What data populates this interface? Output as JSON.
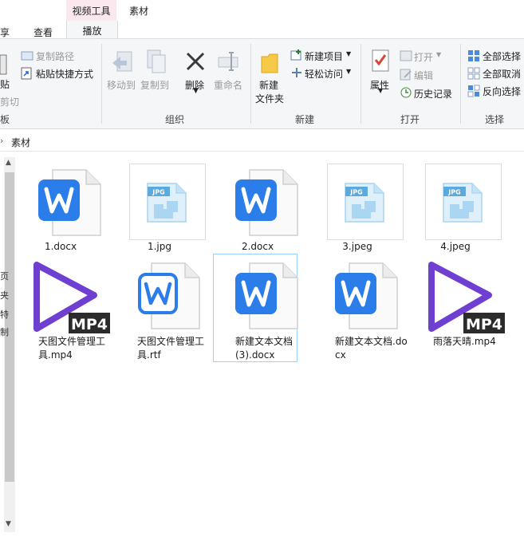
{
  "tabs": {
    "contextual_group": "视频工具",
    "share": "享",
    "view": "查看",
    "play": "播放",
    "folder_title": "素材"
  },
  "ribbon": {
    "clipboard": {
      "paste_fragment": "贴",
      "copy_path": "复制路径",
      "paste_shortcut": "粘贴快捷方式",
      "cut_fragment": "剪切",
      "label": "板"
    },
    "organize": {
      "move_to": "移动到",
      "copy_to": "复制到",
      "delete": "删除",
      "rename": "重命名",
      "label": "组织"
    },
    "new": {
      "new_folder_line1": "新建",
      "new_folder_line2": "文件夹",
      "new_item": "新建项目",
      "easy_access": "轻松访问",
      "label": "新建"
    },
    "open": {
      "properties": "属性",
      "open": "打开",
      "edit": "编辑",
      "history": "历史记录",
      "label": "打开"
    },
    "select": {
      "select_all": "全部选择",
      "select_none": "全部取消",
      "invert": "反向选择",
      "label": "选择"
    }
  },
  "address": {
    "path": "素材"
  },
  "nav_fragments": [
    "页",
    "夹",
    "特",
    "制"
  ],
  "files": [
    {
      "name": "1.docx",
      "type": "word-doc",
      "selected": false
    },
    {
      "name": "1.jpg",
      "type": "jpg",
      "selected": false
    },
    {
      "name": "2.docx",
      "type": "word-doc",
      "selected": false
    },
    {
      "name": "3.jpeg",
      "type": "jpg",
      "selected": false
    },
    {
      "name": "4.jpeg",
      "type": "jpg",
      "selected": false
    },
    {
      "name": "天图文件管理工具.mp4",
      "type": "mp4",
      "selected": false
    },
    {
      "name": "天图文件管理工具.rtf",
      "type": "wps-writer",
      "selected": false
    },
    {
      "name": "新建文本文档(3).docx",
      "type": "word-doc",
      "selected": true
    },
    {
      "name": "新建文本文档.docx",
      "type": "word-doc",
      "selected": false
    },
    {
      "name": "雨落天晴.mp4",
      "type": "mp4",
      "selected": false
    }
  ],
  "icon_labels": {
    "jpg": "JPG",
    "mp4": "MP4"
  },
  "colors": {
    "word_blue": "#2b7de9",
    "mp4_purple": "#6e3fd1",
    "selection_border": "#99d1ff",
    "contextual_tab_bg": "#fbe8ee"
  }
}
